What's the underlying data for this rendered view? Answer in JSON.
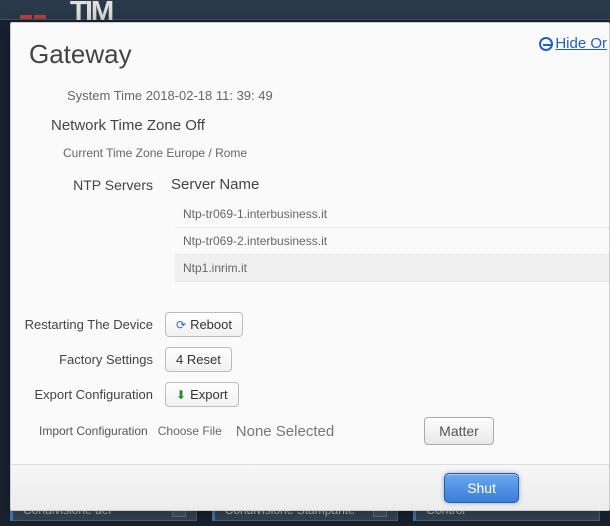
{
  "bg": {
    "logo": "TIM",
    "tiles": [
      "Condivisione dei",
      "Condivisione Stampante",
      "Control"
    ]
  },
  "modal": {
    "title": "Gateway",
    "hide": "Hide Or",
    "system_time_label": "System Time",
    "system_time_value": "2018-02-18 11: 39: 49",
    "ntz": "Network Time Zone Off",
    "ctz_label": "Current Time Zone",
    "ctz_value": "Europe / Rome",
    "ntp_label": "NTP Servers",
    "server_name_header": "Server Name",
    "servers": [
      "Ntp-tr069-1.interbusiness.it",
      "Ntp-tr069-2.interbusiness.it",
      "Ntp1.inrim.it"
    ],
    "restart_label": "Restarting The Device",
    "reboot_btn": "Reboot",
    "factory_label": "Factory Settings",
    "reset_btn": "4 Reset",
    "export_conf_label": "Export Configuration",
    "export_btn": "Export",
    "import_label": "Import Configuration",
    "choose_file": "Choose File",
    "none_selected": "None Selected",
    "matter_btn": "Matter",
    "shut_btn": "Shut"
  }
}
